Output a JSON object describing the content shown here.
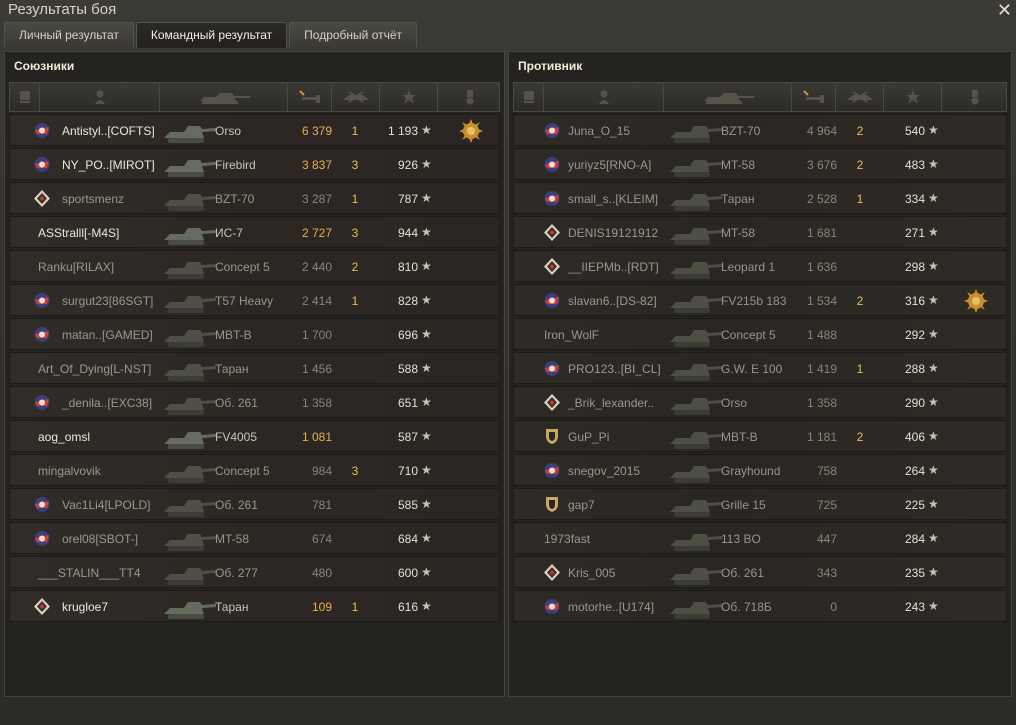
{
  "window": {
    "title": "Результаты боя",
    "close_glyph": "✕"
  },
  "tabs": [
    {
      "label": "Личный результат",
      "active": false
    },
    {
      "label": "Командный результат",
      "active": true
    },
    {
      "label": "Подробный отчёт",
      "active": false
    }
  ],
  "colors": {
    "gold": "#e8b04a",
    "accent": "#e8c060"
  },
  "allies": {
    "title": "Союзники",
    "rows": [
      {
        "name": "Antistyl..[COFTS]",
        "tank": "Orso",
        "damage": "6 379",
        "kills": "1",
        "xp": "1 193",
        "badge": "clan-emblem-icon",
        "medal": "medal-3-icon",
        "state": "me"
      },
      {
        "name": "NY_PO..[MIROT]",
        "tank": "Firebird",
        "damage": "3 837",
        "kills": "3",
        "xp": "926",
        "badge": "clan-emblem-icon",
        "state": "alive"
      },
      {
        "name": "sportsmenz",
        "tank": "BZT-70",
        "damage": "3 287",
        "kills": "1",
        "xp": "787",
        "badge": "rank-icon",
        "state": "dead"
      },
      {
        "name": "ASStralll[-M4S]",
        "tank": "ИС-7",
        "damage": "2 727",
        "kills": "3",
        "xp": "944",
        "badge": "",
        "state": "alive"
      },
      {
        "name": "Ranku[RILAX]",
        "tank": "Concept 5",
        "damage": "2 440",
        "kills": "2",
        "xp": "810",
        "badge": "",
        "state": "dead"
      },
      {
        "name": "surgut23[86SGT]",
        "tank": "T57 Heavy",
        "damage": "2 414",
        "kills": "1",
        "xp": "828",
        "badge": "clan-emblem-icon",
        "state": "dead"
      },
      {
        "name": "matan..[GAMED]",
        "tank": "MBT-B",
        "damage": "1 700",
        "kills": "",
        "xp": "696",
        "badge": "clan-emblem-icon",
        "state": "dead"
      },
      {
        "name": "Art_Of_Dying[L-NST]",
        "tank": "Таран",
        "damage": "1 456",
        "kills": "",
        "xp": "588",
        "badge": "",
        "state": "dead"
      },
      {
        "name": "_denila..[EXC38]",
        "tank": "Об. 261",
        "damage": "1 358",
        "kills": "",
        "xp": "651",
        "badge": "clan-emblem-icon",
        "state": "dead"
      },
      {
        "name": "aog_omsl",
        "tank": "FV4005",
        "damage": "1 081",
        "kills": "",
        "xp": "587",
        "badge": "",
        "state": "alive"
      },
      {
        "name": "mingalvovik",
        "tank": "Concept 5",
        "damage": "984",
        "kills": "3",
        "xp": "710",
        "badge": "",
        "state": "dead"
      },
      {
        "name": "Vac1Li4[LPOLD]",
        "tank": "Об. 261",
        "damage": "781",
        "kills": "",
        "xp": "585",
        "badge": "clan-emblem-icon",
        "state": "dead"
      },
      {
        "name": "orel08[SBOT-]",
        "tank": "MT-58",
        "damage": "674",
        "kills": "",
        "xp": "684",
        "badge": "clan-emblem-icon",
        "state": "dead"
      },
      {
        "name": "___STALIN___TT4",
        "tank": "Об. 277",
        "damage": "480",
        "kills": "",
        "xp": "600",
        "badge": "",
        "state": "dead"
      },
      {
        "name": "krugloe7",
        "tank": "Таран",
        "damage": "109",
        "kills": "1",
        "xp": "616",
        "badge": "rank-icon",
        "state": "alive"
      }
    ]
  },
  "enemies": {
    "title": "Противник",
    "rows": [
      {
        "name": "Juna_O_15",
        "tank": "BZT-70",
        "damage": "4 964",
        "kills": "2",
        "xp": "540",
        "badge": "clan-emblem-icon",
        "state": "dead"
      },
      {
        "name": "yuriyz5[RNO-A]",
        "tank": "MT-58",
        "damage": "3 676",
        "kills": "2",
        "xp": "483",
        "badge": "clan-emblem-icon",
        "state": "dead"
      },
      {
        "name": "small_s..[KLEIM]",
        "tank": "Таран",
        "damage": "2 528",
        "kills": "1",
        "xp": "334",
        "badge": "clan-emblem-icon",
        "state": "dead"
      },
      {
        "name": "DENIS19121912",
        "tank": "MT-58",
        "damage": "1 681",
        "kills": "",
        "xp": "271",
        "badge": "rank-icon",
        "state": "dead"
      },
      {
        "name": "__IIEPMb..[RDT]",
        "tank": "Leopard 1",
        "damage": "1 636",
        "kills": "",
        "xp": "298",
        "badge": "rank-icon",
        "state": "dead"
      },
      {
        "name": "slavan6..[DS-82]",
        "tank": "FV215b 183",
        "damage": "1 534",
        "kills": "2",
        "xp": "316",
        "badge": "clan-emblem-icon",
        "medal": "medal-icon",
        "state": "dead"
      },
      {
        "name": "Iron_WolF",
        "tank": "Concept 5",
        "damage": "1 488",
        "kills": "",
        "xp": "292",
        "badge": "",
        "state": "dead"
      },
      {
        "name": "PRO123..[BI_CL]",
        "tank": "G.W. E 100",
        "damage": "1 419",
        "kills": "1",
        "xp": "288",
        "badge": "clan-emblem-icon",
        "state": "dead"
      },
      {
        "name": "_Brik_lexander..",
        "tank": "Orso",
        "damage": "1 358",
        "kills": "",
        "xp": "290",
        "badge": "rank-icon",
        "state": "dead"
      },
      {
        "name": "GuP_Pi",
        "tank": "MBT-B",
        "damage": "1 181",
        "kills": "2",
        "xp": "406",
        "badge": "shield-icon",
        "state": "dead"
      },
      {
        "name": "snegov_2015",
        "tank": "Grayhound",
        "damage": "758",
        "kills": "",
        "xp": "264",
        "badge": "clan-emblem-icon",
        "state": "dead"
      },
      {
        "name": "gap7",
        "tank": "Grille 15",
        "damage": "725",
        "kills": "",
        "xp": "225",
        "badge": "shield-icon",
        "state": "dead"
      },
      {
        "name": "1973fast",
        "tank": "113 BO",
        "damage": "447",
        "kills": "",
        "xp": "284",
        "badge": "",
        "state": "dead"
      },
      {
        "name": "Kris_005",
        "tank": "Об. 261",
        "damage": "343",
        "kills": "",
        "xp": "235",
        "badge": "rank-icon",
        "state": "dead"
      },
      {
        "name": "motorhe..[U174]",
        "tank": "Об. 718Б",
        "damage": "0",
        "kills": "",
        "xp": "243",
        "badge": "clan-emblem-icon",
        "state": "dead"
      }
    ]
  },
  "star_glyph": "★"
}
